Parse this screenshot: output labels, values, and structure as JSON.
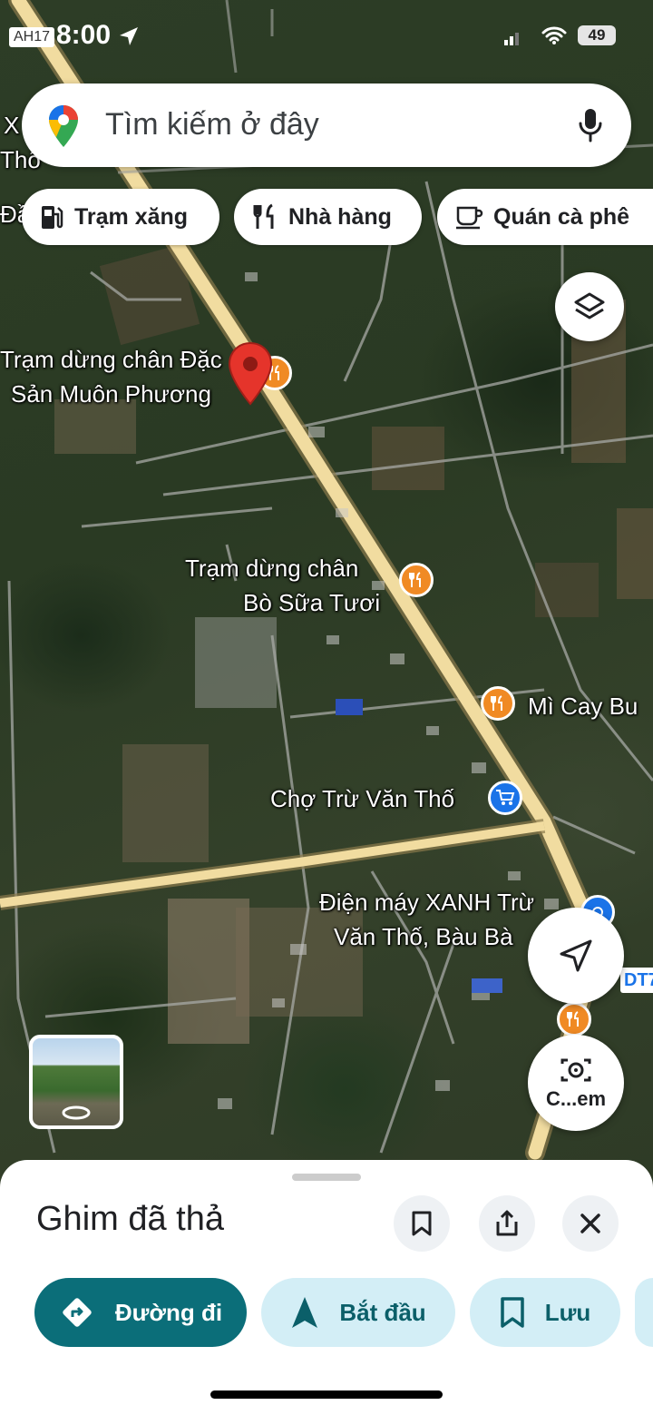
{
  "status_bar": {
    "carrier": "AH17",
    "time": "8:00",
    "battery": "49"
  },
  "search": {
    "placeholder": "Tìm kiếm ở đây"
  },
  "chips": [
    {
      "label": "Trạm xăng",
      "icon": "gas-station-icon"
    },
    {
      "label": "Nhà hàng",
      "icon": "restaurant-icon"
    },
    {
      "label": "Quán cà phê",
      "icon": "coffee-icon"
    }
  ],
  "map_labels": {
    "poi_1_line1": "Trạm dừng chân Đặc",
    "poi_1_line2": "Sản Muôn Phương",
    "poi_2_line1": "Trạm dừng chân",
    "poi_2_line2": "Bò Sữa Tươi",
    "poi_3": "Mì Cay Bu",
    "poi_4": "Chợ Trừ Văn Thố",
    "poi_5_line1": "Điện máy XANH Trừ",
    "poi_5_line2": "Văn Thố, Bàu Bà",
    "road_badge": "DT7",
    "edge_left_1": "X",
    "edge_left_2": "Thổ",
    "edge_left_3": "Đầ"
  },
  "camera_button": {
    "label": "C...em"
  },
  "sheet": {
    "title": "Ghim đã thả",
    "actions": [
      {
        "label": "Đường đi",
        "icon": "directions-icon"
      },
      {
        "label": "Bắt đầu",
        "icon": "navigation-arrow-icon"
      },
      {
        "label": "Lưu",
        "icon": "bookmark-icon"
      }
    ]
  },
  "colors": {
    "primary_teal": "#0b6e79",
    "light_teal": "#d3eef6",
    "poi_orange": "#f08a24",
    "pin_red": "#e5342b",
    "road_yellow": "#f1dca0"
  }
}
